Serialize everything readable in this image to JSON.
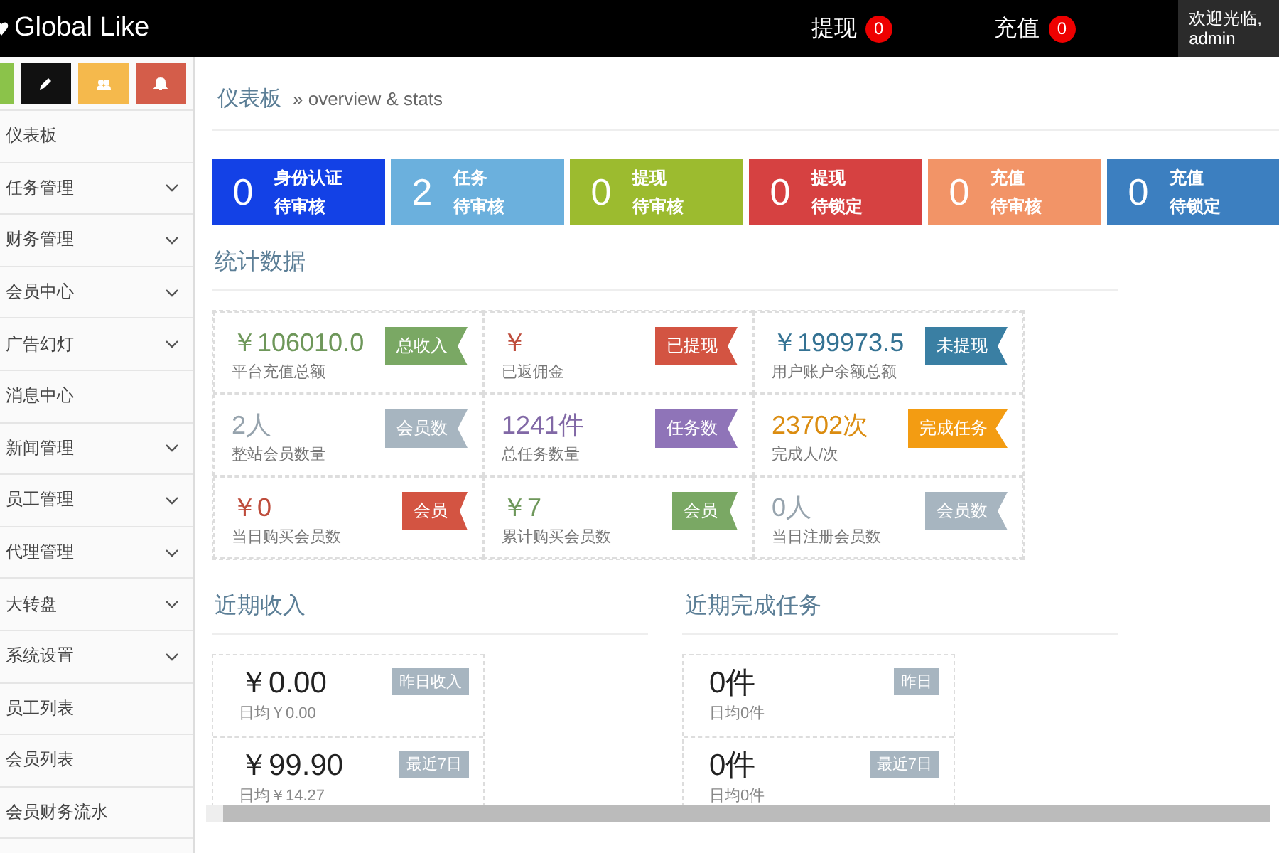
{
  "header": {
    "brand": "Global Like",
    "alerts": [
      {
        "label": "提现",
        "count": "0"
      },
      {
        "label": "充值",
        "count": "0"
      }
    ],
    "user": {
      "greeting": "欢迎光临,",
      "name": "admin"
    }
  },
  "sidebar": {
    "items": [
      {
        "label": "仪表板",
        "expandable": false
      },
      {
        "label": "任务管理",
        "expandable": true
      },
      {
        "label": "财务管理",
        "expandable": true
      },
      {
        "label": "会员中心",
        "expandable": true
      },
      {
        "label": "广告幻灯",
        "expandable": true
      },
      {
        "label": "消息中心",
        "expandable": false
      },
      {
        "label": "新闻管理",
        "expandable": true
      },
      {
        "label": "员工管理",
        "expandable": true
      },
      {
        "label": "代理管理",
        "expandable": true
      },
      {
        "label": "大转盘",
        "expandable": true
      },
      {
        "label": "系统设置",
        "expandable": true
      },
      {
        "label": "员工列表",
        "expandable": false
      },
      {
        "label": "会员列表",
        "expandable": false
      },
      {
        "label": "会员财务流水",
        "expandable": false
      }
    ]
  },
  "breadcrumb": {
    "title": "仪表板",
    "subtitle": "» overview & stats"
  },
  "tiles": [
    {
      "count": "0",
      "title": "身份认证",
      "status": "待审核",
      "color": "#1341e6"
    },
    {
      "count": "2",
      "title": "任务",
      "status": "待审核",
      "color": "#6bb0dd"
    },
    {
      "count": "0",
      "title": "提现",
      "status": "待审核",
      "color": "#9cbb2f"
    },
    {
      "count": "0",
      "title": "提现",
      "status": "待锁定",
      "color": "#d64141"
    },
    {
      "count": "0",
      "title": "充值",
      "status": "待审核",
      "color": "#f29467"
    },
    {
      "count": "0",
      "title": "充值",
      "status": "待锁定",
      "color": "#3c7fc0"
    }
  ],
  "stats": {
    "title": "统计数据",
    "cells": [
      {
        "value": "￥106010.0",
        "caption": "平台充值总额",
        "tag": "总收入",
        "color": "#7aa864"
      },
      {
        "value": "￥",
        "caption": "已返佣金",
        "tag": "已提现",
        "color": "#d35442"
      },
      {
        "value": "￥199973.5",
        "caption": "用户账户余额总额",
        "tag": "未提现",
        "color": "#3a7fa3"
      },
      {
        "value": "2人",
        "caption": "整站会员数量",
        "tag": "会员数",
        "color": "#a7b5c0"
      },
      {
        "value": "1241件",
        "caption": "总任务数量",
        "tag": "任务数",
        "color": "#8f74b8"
      },
      {
        "value": "23702次",
        "caption": "完成人/次",
        "tag": "完成任务",
        "color": "#f39c12"
      },
      {
        "value": "￥0",
        "caption": "当日购买会员数",
        "tag": "会员",
        "color": "#d35442"
      },
      {
        "value": "￥7",
        "caption": "累计购买会员数",
        "tag": "会员",
        "color": "#7aa864"
      },
      {
        "value": "0人",
        "caption": "当日注册会员数",
        "tag": "会员数",
        "color": "#a7b5c0"
      }
    ]
  },
  "recent": [
    {
      "title": "近期收入",
      "rows": [
        {
          "value": "￥0.00",
          "average": "日均￥0.00",
          "tag": "昨日收入"
        },
        {
          "value": "￥99.90",
          "average": "日均￥14.27",
          "tag": "最近7日"
        }
      ]
    },
    {
      "title": "近期完成任务",
      "rows": [
        {
          "value": "0件",
          "average": "日均0件",
          "tag": "昨日"
        },
        {
          "value": "0件",
          "average": "日均0件",
          "tag": "最近7日"
        }
      ]
    }
  ]
}
